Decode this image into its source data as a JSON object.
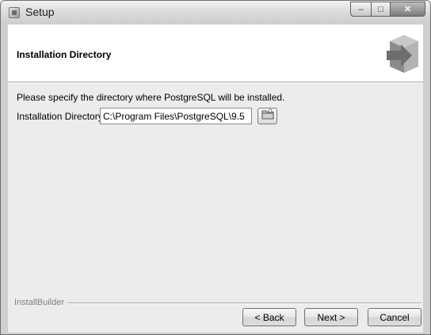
{
  "window": {
    "title": "Setup",
    "icon": "installer-icon",
    "controls": {
      "minimize": "‒",
      "maximize": "□",
      "close": "✕"
    }
  },
  "header": {
    "title": "Installation Directory",
    "icon": "box-arrow-icon"
  },
  "body": {
    "prompt": "Please specify the directory where PostgreSQL will be installed.",
    "directory_label": "Installation Directory",
    "directory_value": "C:\\Program Files\\PostgreSQL\\9.5",
    "browse_icon": "folder-browse-icon"
  },
  "footer": {
    "brand": "InstallBuilder",
    "back_label": "< Back",
    "next_label": "Next >",
    "cancel_label": "Cancel"
  }
}
